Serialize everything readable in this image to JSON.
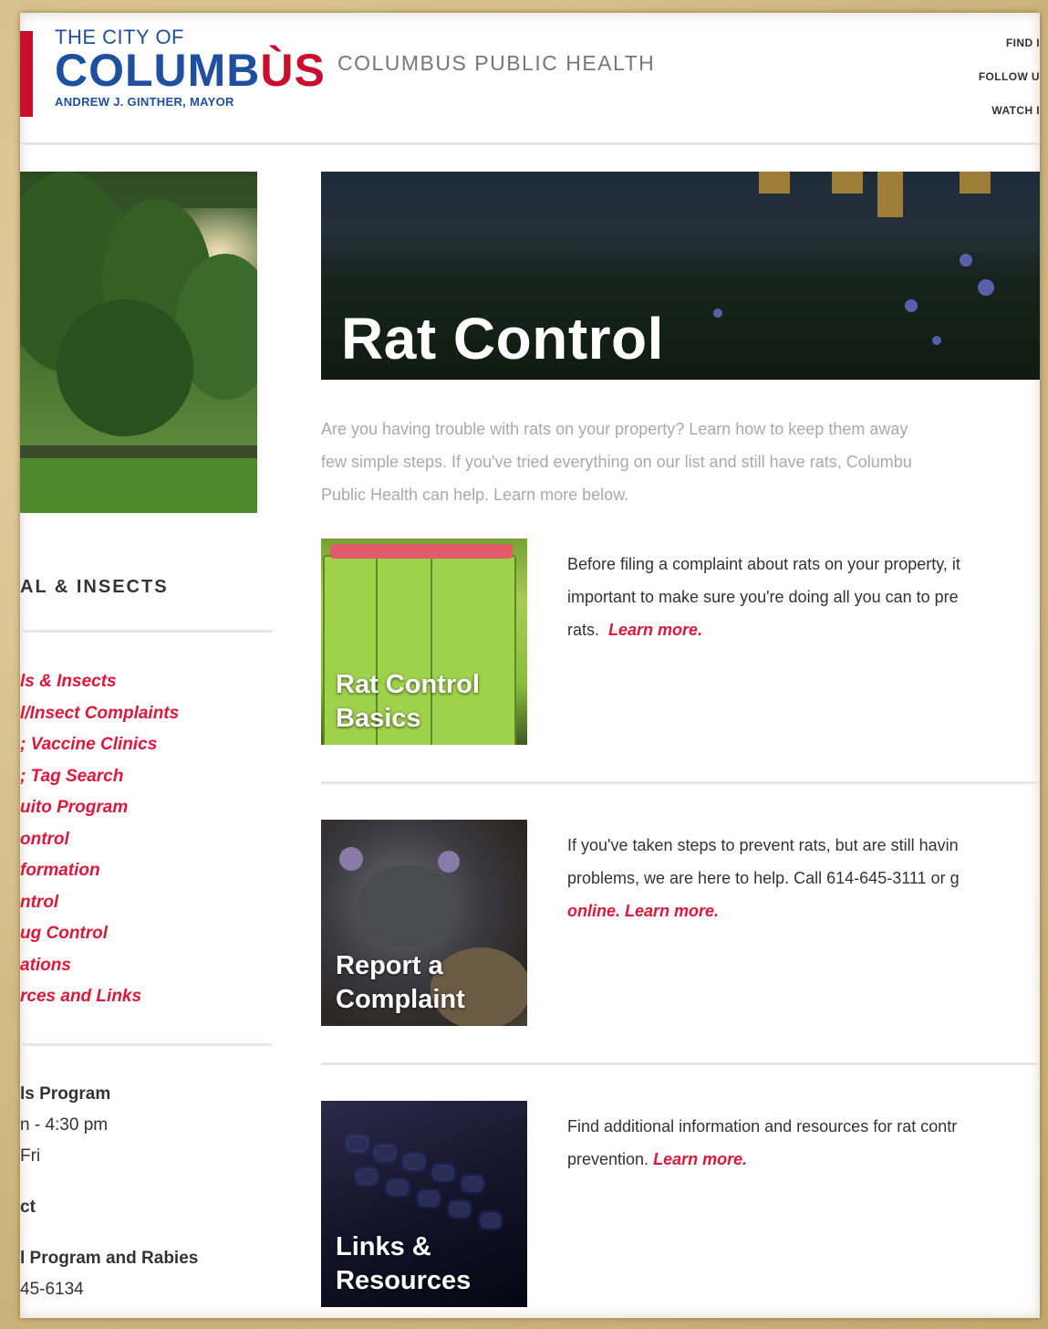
{
  "header": {
    "logo_top": "THE CITY OF",
    "logo_main_a": "COLUMB",
    "logo_main_b": "ÙS",
    "logo_sub": "ANDREW J. GINTHER, MAYOR",
    "department": "COLUMBUS PUBLIC HEALTH",
    "utility_links": [
      "FIND I",
      "FOLLOW U",
      "WATCH I"
    ]
  },
  "sidebar": {
    "heading": "AL & INSECTS",
    "links": [
      "ls & Insects",
      "l/Insect Complaints",
      "; Vaccine Clinics",
      "; Tag Search",
      "uito Program",
      "ontrol",
      "formation",
      "ntrol",
      "ug Control",
      "ations",
      "rces and Links"
    ],
    "contact_program": "ls Program",
    "contact_hours": "n - 4:30 pm",
    "contact_days": "Fri",
    "contact_heading": "ct",
    "contact_name": "l Program and Rabies",
    "contact_phone": "45-6134"
  },
  "hero": {
    "title": "Rat Control"
  },
  "intro": {
    "line1": "Are you having trouble with rats on your property? Learn how to keep them away",
    "line2": "few simple steps. If you've tried everything on our list and still have rats, Columbu",
    "line3": "Public Health can help. Learn more below."
  },
  "cards": [
    {
      "label_1": "Rat Control",
      "label_2": "Basics",
      "text_1": "Before filing a complaint about rats on your property, it",
      "text_2": "important to make sure you're doing all you can to pre",
      "text_3": "rats.",
      "learn_more": "Learn more."
    },
    {
      "label_1": "Report a",
      "label_2": "Complaint",
      "text_1": "If you've taken steps to prevent rats, but are still havin",
      "text_2": "problems, we are here to help. Call 614-645-3111 or g",
      "text_3": "online.",
      "learn_more": "Learn more."
    },
    {
      "label_1": "Links &",
      "label_2": "Resources",
      "text_1": "Find additional information and resources for rat contr",
      "text_2": "prevention.",
      "learn_more": "Learn more."
    }
  ],
  "colors": {
    "accent_red": "#e0163b",
    "brand_blue": "#1f4fa0",
    "brand_red": "#c8102e"
  }
}
